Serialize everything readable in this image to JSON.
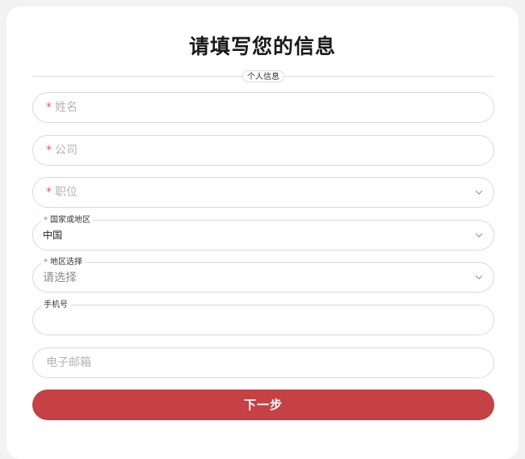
{
  "form": {
    "title": "请填写您的信息",
    "section_label": "个人信息",
    "name": {
      "required": "*",
      "placeholder": "姓名"
    },
    "company": {
      "required": "*",
      "placeholder": "公司"
    },
    "position": {
      "required": "*",
      "placeholder": "职位"
    },
    "country": {
      "required": "*",
      "label": "国家或地区",
      "value": "中国"
    },
    "region": {
      "required": "*",
      "label": "地区选择",
      "placeholder": "请选择"
    },
    "phone": {
      "label": "手机号",
      "value": ""
    },
    "email": {
      "placeholder": "电子邮箱"
    },
    "next_label": "下一步"
  },
  "icons": {
    "chevron": "chevron-down-icon"
  },
  "colors": {
    "accent": "#c54144",
    "required": "#e05a57",
    "border": "#d9d9d9",
    "background": "#f2f2f2"
  }
}
